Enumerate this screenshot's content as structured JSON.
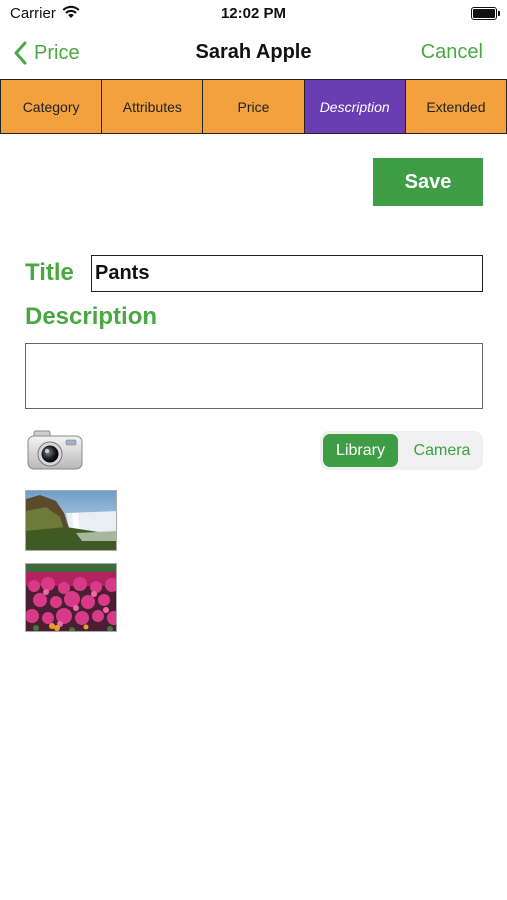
{
  "status_bar": {
    "carrier": "Carrier",
    "time": "12:02 PM"
  },
  "nav": {
    "back_label": "Price",
    "title": "Sarah Apple",
    "cancel_label": "Cancel"
  },
  "tabs": [
    {
      "label": "Category"
    },
    {
      "label": "Attributes"
    },
    {
      "label": "Price"
    },
    {
      "label": "Description",
      "active": true
    },
    {
      "label": "Extended"
    }
  ],
  "save_label": "Save",
  "form": {
    "title_label": "Title",
    "title_value": "Pants",
    "description_label": "Description",
    "description_value": ""
  },
  "segmented": {
    "selected": "Library",
    "options": [
      "Library",
      "Camera"
    ]
  },
  "photos": [
    {
      "icon": "waterfall-photo"
    },
    {
      "icon": "flowers-photo"
    }
  ],
  "colors": {
    "accent": "#4aa843",
    "save": "#3e9d45",
    "tab": "#f2a13c",
    "tab_active": "#6b3db3"
  }
}
